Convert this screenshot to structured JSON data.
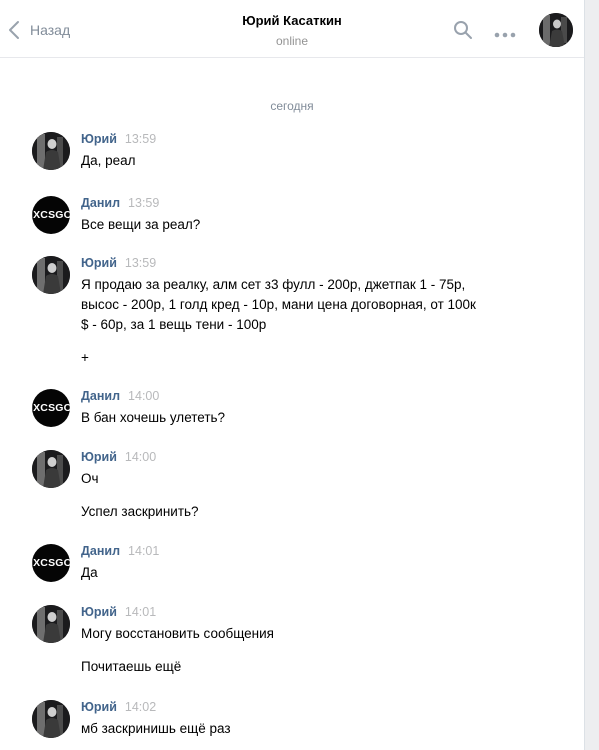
{
  "header": {
    "back_label": "Назад",
    "peer_name": "Юрий Касаткин",
    "peer_status": "online"
  },
  "date_separator": "сегодня",
  "danil_avatar_text": "IXCSGO",
  "messages": [
    {
      "author": "Юрий",
      "time": "13:59",
      "paragraphs": [
        [
          "Да, реал"
        ]
      ]
    },
    {
      "author": "Данил",
      "time": "13:59",
      "paragraphs": [
        [
          "Все вещи за реал?"
        ]
      ]
    },
    {
      "author": "Юрий",
      "time": "13:59",
      "paragraphs": [
        [
          "Я продаю за реалку, алм сет з3 фулл - 200р, джетпак 1 - 75р,",
          "высос - 200р, 1 голд кред - 10р, мани цена договорная, от 100к",
          "$ - 60р, за 1 вещь тени - 100р"
        ],
        [
          "+"
        ]
      ]
    },
    {
      "author": "Данил",
      "time": "14:00",
      "paragraphs": [
        [
          "В бан хочешь улететь?"
        ]
      ]
    },
    {
      "author": "Юрий",
      "time": "14:00",
      "paragraphs": [
        [
          "Оч"
        ],
        [
          "Успел заскринить?"
        ]
      ]
    },
    {
      "author": "Данил",
      "time": "14:01",
      "paragraphs": [
        [
          "Да"
        ]
      ]
    },
    {
      "author": "Юрий",
      "time": "14:01",
      "paragraphs": [
        [
          "Могу восстановить сообщения"
        ],
        [
          "Почитаешь ещё"
        ]
      ]
    },
    {
      "author": "Юрий",
      "time": "14:02",
      "paragraphs": [
        [
          "мб заскринишь ещё раз"
        ]
      ]
    }
  ],
  "colors": {
    "author_link": "#42648b",
    "muted": "#818c99",
    "timestamp": "#b8b9bb",
    "page_bg": "#edeef0"
  },
  "icons": [
    "chevron-left-icon",
    "search-icon",
    "more-dots-icon"
  ]
}
